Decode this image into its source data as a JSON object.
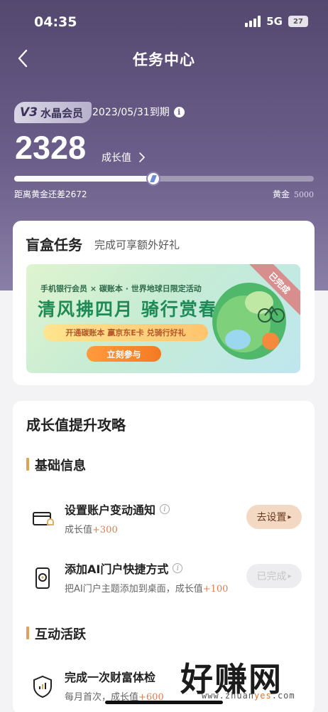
{
  "status_bar": {
    "time": "04:35",
    "network": "5G",
    "battery": "27"
  },
  "header": {
    "title": "任务中心"
  },
  "member": {
    "badge_mark": "V3",
    "badge_label": "水晶会员",
    "expire_text": "2023/05/31到期",
    "growth_value": "2328",
    "growth_label": "成长值",
    "progress_fraction": 0.4656,
    "gap_text": "距离黄金还差2672",
    "next_level_label": "黄金",
    "next_level_value": "5000"
  },
  "blind_box": {
    "title": "盲盒任务",
    "subtitle": "完成可享额外好礼",
    "banner": {
      "top_text": "手机银行会员 × 碳账本 · 世界地球日限定活动",
      "main_text": "清风拂四月 骑行赏春色",
      "strip_text": "开通碳账本 赢京东E卡 兑骑行好礼",
      "button_label": "立刻参与",
      "ribbon_label": "已完成"
    }
  },
  "guide": {
    "title": "成长值提升攻略",
    "sections": [
      {
        "title": "基础信息"
      },
      {
        "title": "互动活跃"
      }
    ],
    "tasks": [
      {
        "name": "设置账户变动通知",
        "desc_prefix": "成长值",
        "desc_plus": "+300",
        "button": "去设置",
        "icon": "card-bell-icon"
      },
      {
        "name": "添加AI门户快捷方式",
        "desc_prefix": "把AI门户主题添加到桌面，成长值",
        "desc_plus": "+100",
        "button": "已完成",
        "icon": "phone-shortcut-icon"
      },
      {
        "name": "完成一次财富体检",
        "desc_prefix": "每月首次，成长值",
        "desc_plus": "+600",
        "icon": "shield-chart-icon"
      }
    ]
  },
  "watermark": {
    "big": "好赚网",
    "small_a": "www.zhuan",
    "small_b": "yes",
    "small_c": ".com"
  },
  "colors": {
    "header_bg": "#5f5380",
    "accent_gold": "#d8a656",
    "plus_orange": "#d88050"
  }
}
